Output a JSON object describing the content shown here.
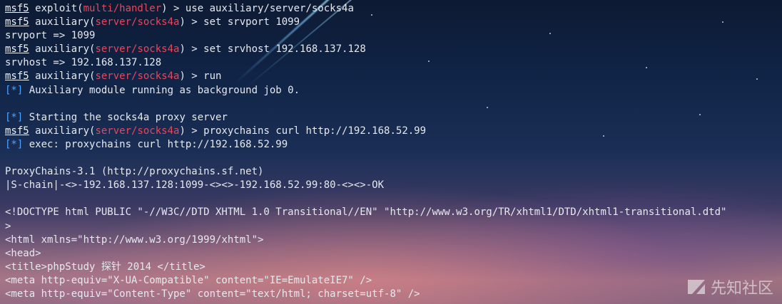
{
  "terminal": {
    "lines": [
      {
        "type": "cmd",
        "prompt": "msf5",
        "pre": " exploit(",
        "module": "multi/handler",
        "post": ") > use auxiliary/server/socks4a"
      },
      {
        "type": "cmd",
        "prompt": "msf5",
        "pre": " auxiliary(",
        "module": "server/socks4a",
        "post": ") > set srvport 1099"
      },
      {
        "type": "plain",
        "text": "srvport => 1099"
      },
      {
        "type": "cmd",
        "prompt": "msf5",
        "pre": " auxiliary(",
        "module": "server/socks4a",
        "post": ") > set srvhost 192.168.137.128"
      },
      {
        "type": "plain",
        "text": "srvhost => 192.168.137.128"
      },
      {
        "type": "cmd",
        "prompt": "msf5",
        "pre": " auxiliary(",
        "module": "server/socks4a",
        "post": ") > run"
      },
      {
        "type": "info",
        "tag": "[*]",
        "text": " Auxiliary module running as background job 0."
      },
      {
        "type": "plain",
        "text": ""
      },
      {
        "type": "info",
        "tag": "[*]",
        "text": " Starting the socks4a proxy server"
      },
      {
        "type": "cmd",
        "prompt": "msf5",
        "pre": " auxiliary(",
        "module": "server/socks4a",
        "post": ") > proxychains curl http://192.168.52.99"
      },
      {
        "type": "info",
        "tag": "[*]",
        "text": " exec: proxychains curl http://192.168.52.99"
      },
      {
        "type": "plain",
        "text": ""
      },
      {
        "type": "plain",
        "text": "ProxyChains-3.1 (http://proxychains.sf.net)"
      },
      {
        "type": "plain",
        "text": "|S-chain|-<>-192.168.137.128:1099-<><>-192.168.52.99:80-<><>-OK"
      },
      {
        "type": "plain",
        "text": ""
      },
      {
        "type": "plain",
        "text": "<!DOCTYPE html PUBLIC \"-//W3C//DTD XHTML 1.0 Transitional//EN\" \"http://www.w3.org/TR/xhtml1/DTD/xhtml1-transitional.dtd\""
      },
      {
        "type": "plain",
        "text": ">"
      },
      {
        "type": "plain",
        "text": "<html xmlns=\"http://www.w3.org/1999/xhtml\">"
      },
      {
        "type": "plain",
        "text": "<head>"
      },
      {
        "type": "plain",
        "text": "<title>phpStudy 探针 2014 </title>"
      },
      {
        "type": "plain",
        "text": "<meta http-equiv=\"X-UA-Compatible\" content=\"IE=EmulateIE7\" />"
      },
      {
        "type": "plain",
        "text": "<meta http-equiv=\"Content-Type\" content=\"text/html; charset=utf-8\" />"
      }
    ]
  },
  "watermark": {
    "text": "先知社区",
    "icon": "xianzhi-logo-icon"
  },
  "colors": {
    "module": "#e8475b",
    "info": "#4fa3ff",
    "text": "#e6e9ef"
  }
}
